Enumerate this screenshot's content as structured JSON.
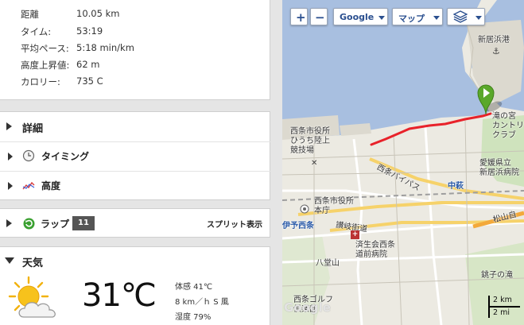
{
  "stats": [
    {
      "label": "距離",
      "value": "10.05 km"
    },
    {
      "label": "タイム:",
      "value": "53:19"
    },
    {
      "label": "平均ペース:",
      "value": "5:18 min/km"
    },
    {
      "label": "高度上昇値:",
      "value": "62 m"
    },
    {
      "label": "カロリー:",
      "value": "735 C"
    }
  ],
  "details": {
    "header": "詳細",
    "timing": "タイミング",
    "elevation": "高度"
  },
  "laps": {
    "label": "ラップ",
    "count": "11",
    "split_link": "スプリット表示"
  },
  "weather": {
    "header": "天気",
    "temperature": "31℃",
    "feels_like": "体感 41℃",
    "wind": "8 km／ｈ S 風",
    "humidity": "湿度 79%"
  },
  "map": {
    "zoom_in": "+",
    "zoom_out": "−",
    "provider": "Google",
    "map_type": "マップ",
    "labels": {
      "port": "新居浜港",
      "club": "滝の宮\nカントリー\nクラブ",
      "hospital_pref": "愛媛県立\n新居浜病院",
      "nakahagi": "中萩",
      "saijo_office_hiuchi": "西条市役所\nひうち陸上\n競技場",
      "saijo_bypass": "西条バイパス",
      "saijo_office_main": "西条市役所\n本庁",
      "iyo_saijo": "伊予西条",
      "sanuki_road": "讃岐街道",
      "hospital_saijo": "済生会西条\n道前病院",
      "matsuyama_road": "松山自",
      "hachijoyama": "八堂山",
      "saijo_golf": "西条ゴルフ\n俱楽部",
      "tsuzuki_falls": "銚子の滝"
    },
    "scale_km": "2 km",
    "scale_mi": "2 mi",
    "watermark": "Google"
  },
  "colors": {
    "route": "#e8222a",
    "sea": "#a8bfe0",
    "land": "#eceae2",
    "marker": "#5aa82a"
  }
}
